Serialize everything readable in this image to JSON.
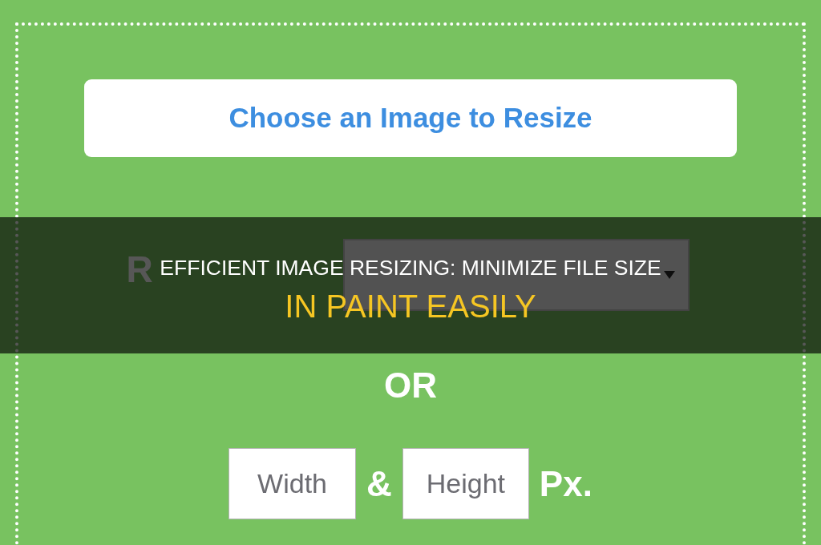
{
  "upload_button": {
    "label": "Choose an Image to Resize"
  },
  "resize_to": {
    "label": "R",
    "dropdown": {
      "expanded": false
    }
  },
  "title_banner": {
    "line_1": "EFFICIENT IMAGE RESIZING: MINIMIZE FILE SIZE",
    "line_2": "IN PAINT EASILY"
  },
  "separator": "OR",
  "dimensions": {
    "width_field": {
      "placeholder": "Width"
    },
    "joiner": "&",
    "height_field": {
      "placeholder": "Height"
    },
    "unit": "Px."
  }
}
